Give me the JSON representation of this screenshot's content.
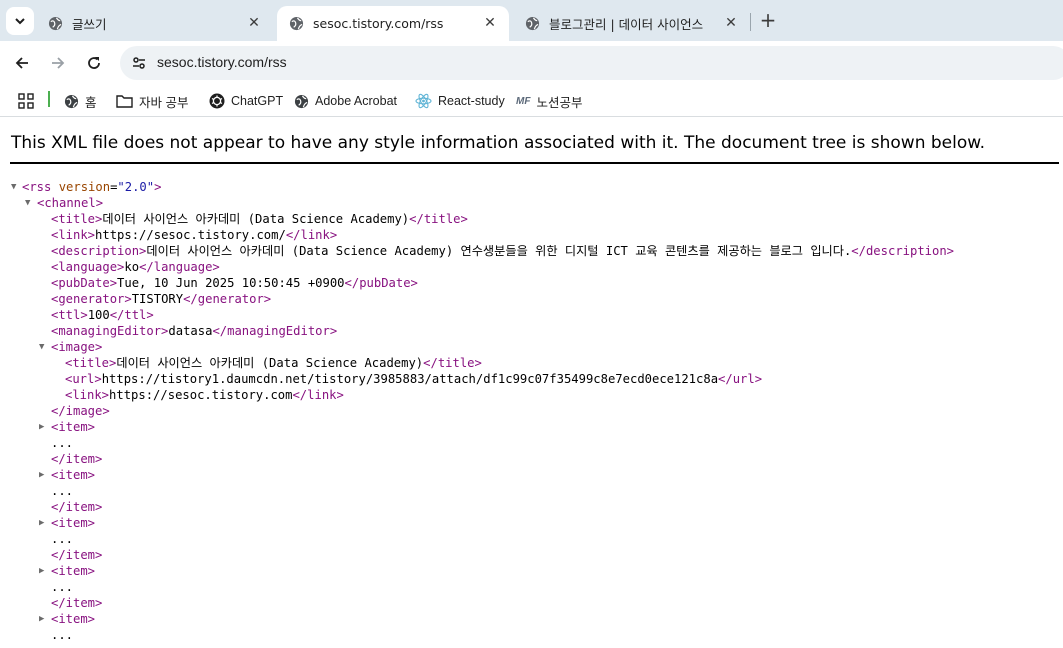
{
  "tabs": [
    {
      "title": "글쓰기",
      "active": false
    },
    {
      "title": "sesoc.tistory.com/rss",
      "active": true
    },
    {
      "title": "블로그관리 | 데이터 사이언스",
      "active": false
    }
  ],
  "address_bar": {
    "url": "sesoc.tistory.com/rss"
  },
  "bookmarks": [
    {
      "label": "홈",
      "icon": "globe-icon"
    },
    {
      "label": "자바 공부",
      "icon": "folder-icon"
    },
    {
      "label": "ChatGPT",
      "icon": "chatgpt-icon"
    },
    {
      "label": "Adobe Acrobat",
      "icon": "globe-icon"
    },
    {
      "label": "React-study",
      "icon": "react-icon"
    },
    {
      "label": "노션공부",
      "icon": "mf-icon",
      "icon_text": "MF"
    }
  ],
  "xml_notice": "This XML file does not appear to have any style information associated with it. The document tree is shown below.",
  "xml": {
    "rss_open": "<rss",
    "rss_attr_name": "version",
    "rss_attr_value": "\"2.0\"",
    "rss_close_bracket": ">",
    "channel_open": "<channel>",
    "channel": {
      "title": "데이터 사이언스 아카데미 (Data Science Academy)",
      "link": "https://sesoc.tistory.com/",
      "description": "데이터 사이언스 아카데미 (Data Science Academy) 연수생분들을 위한 디지털 ICT 교육 콘텐츠를 제공하는 블로그 입니다.",
      "language": "ko",
      "pubDate": "Tue, 10 Jun 2025 10:50:45 +0900",
      "generator": "TISTORY",
      "ttl": "100",
      "managingEditor": "datasa"
    },
    "image": {
      "title": "데이터 사이언스 아카데미 (Data Science Academy)",
      "url": "https://tistory1.daumcdn.net/tistory/3985883/attach/df1c99c07f35499c8e7ecd0ece121c8a",
      "link": "https://sesoc.tistory.com"
    },
    "item_open": "<item>",
    "item_ellipsis": "...",
    "item_close": "</item>",
    "image_open": "<image>",
    "image_close": "</image>",
    "tags": {
      "title_o": "<title>",
      "title_c": "</title>",
      "link_o": "<link>",
      "link_c": "</link>",
      "description_o": "<description>",
      "description_c": "</description>",
      "language_o": "<language>",
      "language_c": "</language>",
      "pubDate_o": "<pubDate>",
      "pubDate_c": "</pubDate>",
      "generator_o": "<generator>",
      "generator_c": "</generator>",
      "ttl_o": "<ttl>",
      "ttl_c": "</ttl>",
      "managingEditor_o": "<managingEditor>",
      "managingEditor_c": "</managingEditor>",
      "url_o": "<url>",
      "url_c": "</url>"
    }
  }
}
